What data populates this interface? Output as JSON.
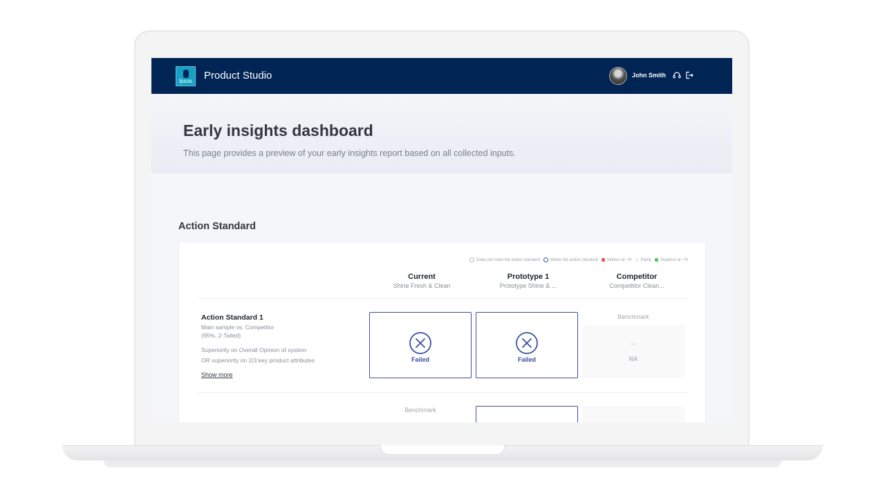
{
  "app": {
    "logo_text": "Ipsos",
    "title": "Product Studio",
    "user_name": "John Smith",
    "icons": [
      "support-icon",
      "logout-icon"
    ]
  },
  "page": {
    "title": "Early insights dashboard",
    "subtitle": "This page provides a preview of your early insights report based on all collected inputs."
  },
  "section": {
    "title": "Action Standard"
  },
  "legend": {
    "items": [
      {
        "label": "Does not meet the action standard"
      },
      {
        "label": "Meets the action standard"
      },
      {
        "label": "Inferior at ~%",
        "color": "#e65a5a"
      },
      {
        "label": "Parity",
        "color": "#eeeeee"
      },
      {
        "label": "Superior at ~%",
        "color": "#5cc46a"
      }
    ]
  },
  "columns": [
    {
      "title": "Current",
      "subtitle": "Shine Fresh & Clean"
    },
    {
      "title": "Prototype 1",
      "subtitle": "Prototype Shine & ..."
    },
    {
      "title": "Competitor",
      "subtitle": "Competitior Clean..."
    }
  ],
  "standards": [
    {
      "title": "Action Standard 1",
      "lines": [
        "Main sample vs. Competitor",
        "(95%, 2-Tailed)",
        "Superiority on Overall Opinion of system",
        "OR superiority on 2/3 key product attributes"
      ],
      "show_more": "Show more",
      "results": [
        "Failed",
        "Failed"
      ],
      "benchmark_label": "Benchmark",
      "benchmark_dash": "--",
      "benchmark_value": "NA"
    },
    {
      "benchmark_label": "Benchmark"
    }
  ],
  "colors": {
    "nav_bg": "#002454",
    "accent": "#3a4fa0"
  }
}
